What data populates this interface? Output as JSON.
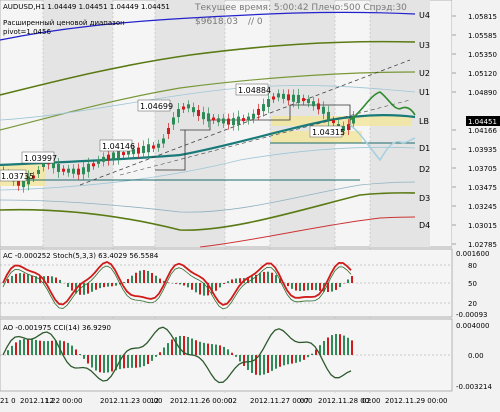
{
  "header": {
    "symbol_line": "AUDUSD,H1  1.04449 1.04451 1.04449 1.04451",
    "server_time": "Текущее время: 5:00:42 Плечо:500 Спрэд:30",
    "equity": "$9618.03",
    "equity_sep": "// 0",
    "indicator_title": "Расширенный ценовой диапазон",
    "pivot": "pivot=1.0456"
  },
  "levels": {
    "U4": "U4",
    "U3": "U3",
    "U2": "U2",
    "U1": "U1",
    "LB": "LB",
    "D1": "D1",
    "D2": "D2",
    "D3": "D3",
    "D4": "D4"
  },
  "price_axis": [
    "1.05815",
    "1.05585",
    "1.05350",
    "1.05120",
    "1.04890",
    "1.04451",
    "1.04166",
    "1.03935",
    "1.03705",
    "1.03475",
    "1.03245",
    "1.03015",
    "1.02785"
  ],
  "current_price": "1.04451",
  "annotations": {
    "p1": "1.04699",
    "p2": "1.04884",
    "p3": "1.04146",
    "p4": "1.03997",
    "p5": "1.03735",
    "p6": "1.04315"
  },
  "ac_panel": {
    "label": "AC -0.000252  Stoch(5,3,3) 63.4029 56.5584",
    "axis": [
      "0.001600",
      "80",
      "50",
      "20",
      "-0.00093"
    ]
  },
  "ao_panel": {
    "label": "AO -0.001975  CCI(14) 36.9290",
    "axis": [
      "0.004000",
      "0.00",
      "-0.003214"
    ]
  },
  "time_axis": [
    "21 0",
    "2012.11.22 00:00",
    "12",
    "2012.11.23 00:00",
    "12",
    "2012.11.26 00:00",
    "02",
    "2012.11.27 00:00",
    "07",
    "2012.11.28 00:00",
    "02",
    "2012.11.29 00:00"
  ],
  "colors": {
    "background": "#f2f2f2",
    "candle_up": "#2e8b57",
    "candle_down": "#d11a1a",
    "ema": "#1a7a7a",
    "envelope_outer": "#5a7a14",
    "envelope_blue": "#2222cc",
    "zone": "#f3e6a0"
  }
}
